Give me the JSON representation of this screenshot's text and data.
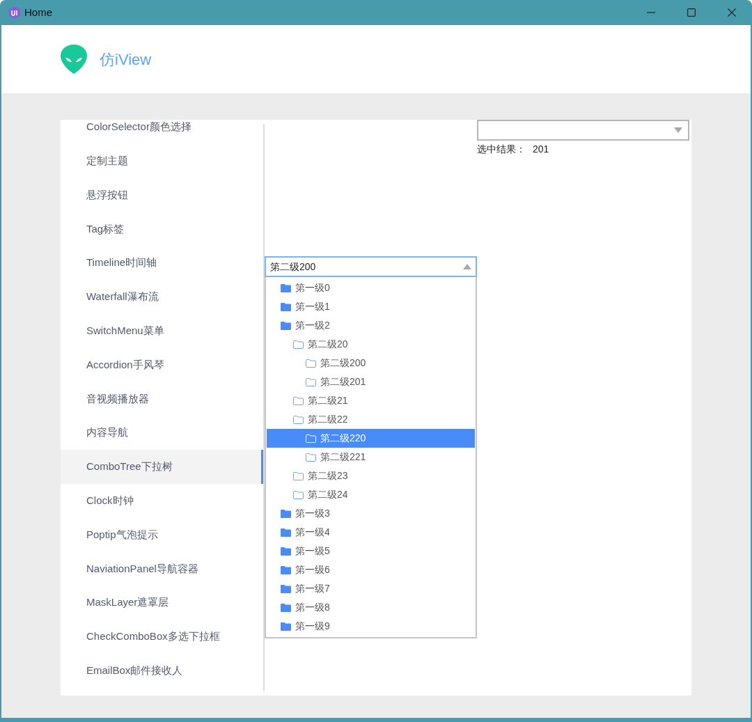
{
  "window": {
    "title": "Home"
  },
  "header": {
    "brand": "仿iView"
  },
  "sidebar": {
    "items": [
      {
        "label": "ColorSelector颜色选择",
        "selected": false
      },
      {
        "label": "定制主题",
        "selected": false
      },
      {
        "label": "悬浮按钮",
        "selected": false
      },
      {
        "label": "Tag标签",
        "selected": false
      },
      {
        "label": "Timeline时间轴",
        "selected": false
      },
      {
        "label": "Waterfall瀑布流",
        "selected": false
      },
      {
        "label": "SwitchMenu菜单",
        "selected": false
      },
      {
        "label": "Accordion手风琴",
        "selected": false
      },
      {
        "label": "音视频播放器",
        "selected": false
      },
      {
        "label": "内容导航",
        "selected": false
      },
      {
        "label": "ComboTree下拉树",
        "selected": true
      },
      {
        "label": "Clock时钟",
        "selected": false
      },
      {
        "label": "Poptip气泡提示",
        "selected": false
      },
      {
        "label": "NaviationPanel导航容器",
        "selected": false
      },
      {
        "label": "MaskLayer遮罩层",
        "selected": false
      },
      {
        "label": "CheckComboBox多选下拉框",
        "selected": false
      },
      {
        "label": "EmailBox邮件接收人",
        "selected": false
      }
    ]
  },
  "result_combo": {
    "open": false
  },
  "result": {
    "label": "选中结果：",
    "value": "201"
  },
  "combo_tree": {
    "value": "第二级200",
    "open": true,
    "tree": [
      {
        "label": "第一级0",
        "selected": false
      },
      {
        "label": "第一级1",
        "selected": false
      },
      {
        "label": "第一级2",
        "selected": false,
        "children": [
          {
            "label": "第二级20",
            "selected": false,
            "children": [
              {
                "label": "第二级200",
                "selected": false
              },
              {
                "label": "第二级201",
                "selected": false
              }
            ]
          },
          {
            "label": "第二级21",
            "selected": false
          },
          {
            "label": "第二级22",
            "selected": false,
            "children": [
              {
                "label": "第二级220",
                "selected": true
              },
              {
                "label": "第二级221",
                "selected": false
              }
            ]
          },
          {
            "label": "第二级23",
            "selected": false
          },
          {
            "label": "第二级24",
            "selected": false
          }
        ]
      },
      {
        "label": "第一级3",
        "selected": false
      },
      {
        "label": "第一级4",
        "selected": false
      },
      {
        "label": "第一级5",
        "selected": false
      },
      {
        "label": "第一级6",
        "selected": false
      },
      {
        "label": "第一级7",
        "selected": false
      },
      {
        "label": "第一级8",
        "selected": false
      },
      {
        "label": "第一级9",
        "selected": false
      }
    ]
  }
}
